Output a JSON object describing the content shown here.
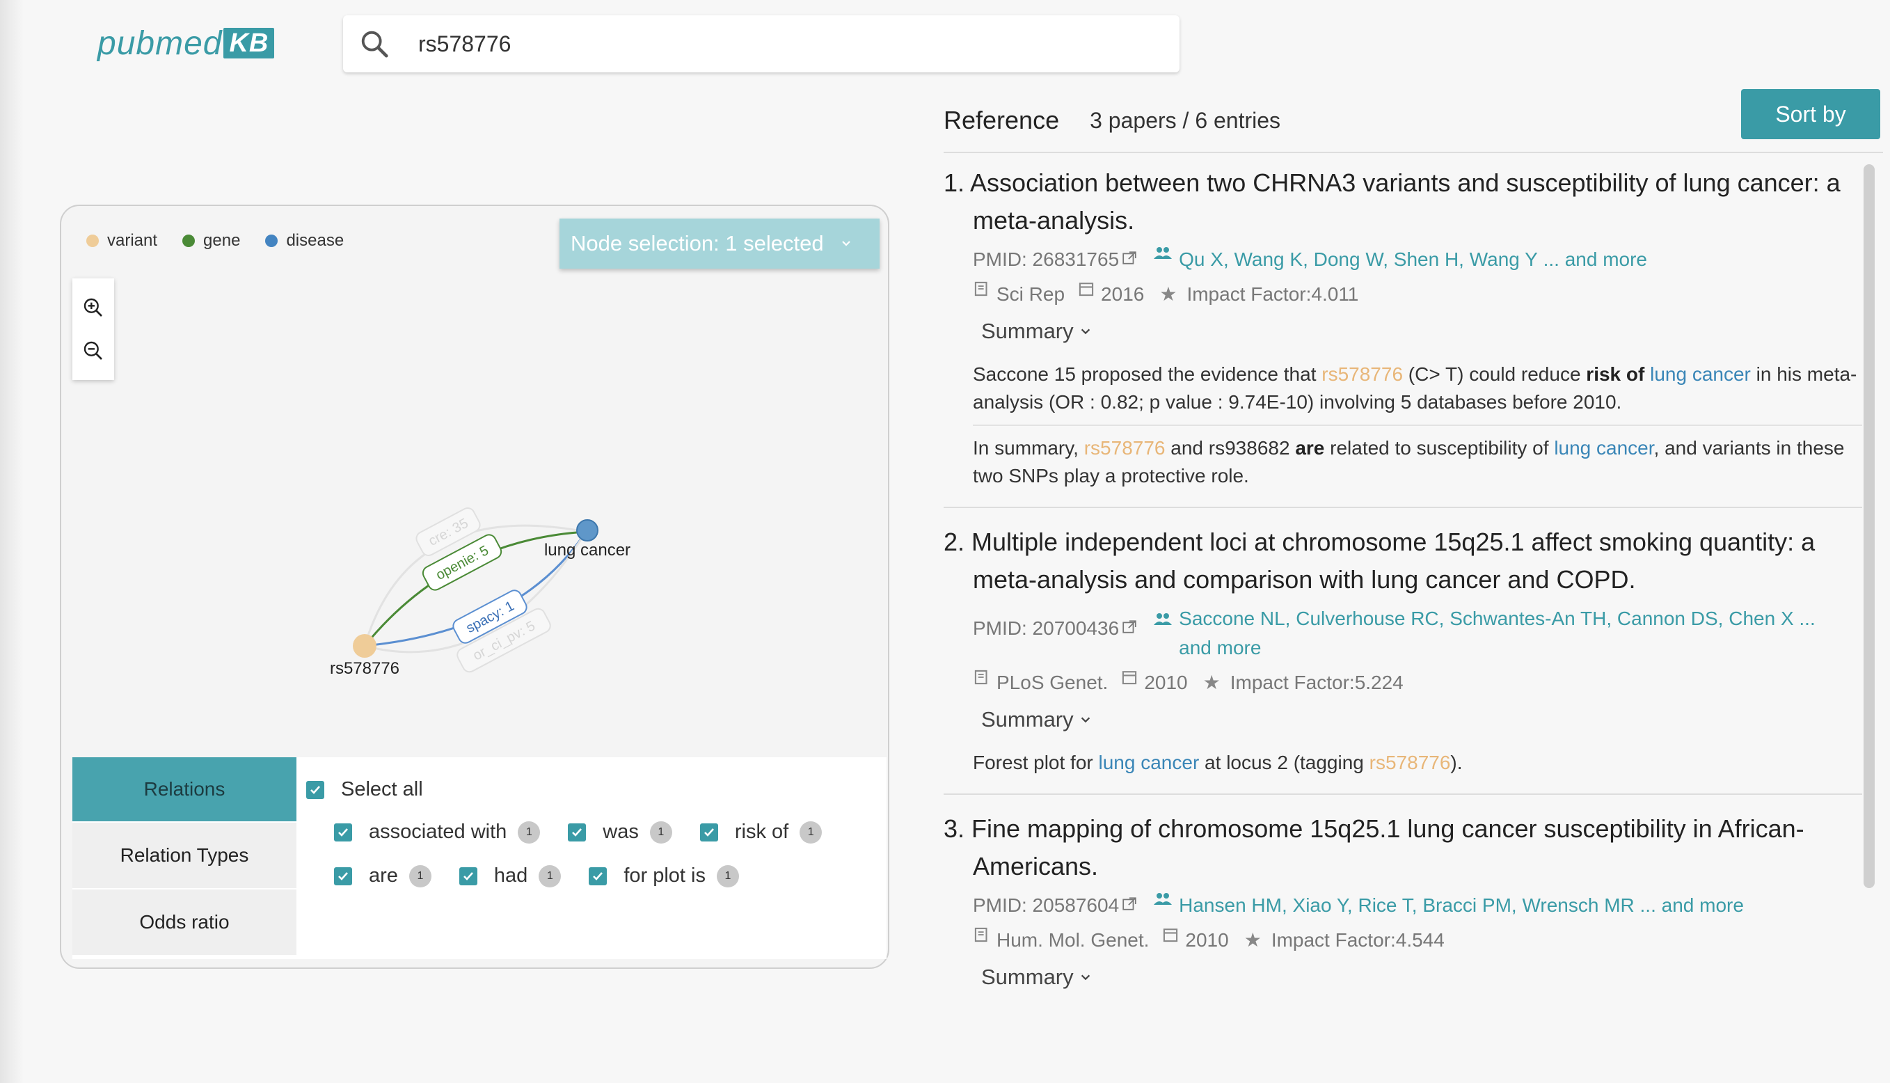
{
  "app": {
    "logo_text": "pubmed",
    "logo_badge": "KB"
  },
  "search": {
    "value": "rs578776",
    "icon": "search-icon"
  },
  "graph": {
    "legend": [
      {
        "label": "variant",
        "color": "#efcc98"
      },
      {
        "label": "gene",
        "color": "#4a8a36"
      },
      {
        "label": "disease",
        "color": "#4384c1"
      }
    ],
    "node_selection_label": "Node selection: 1 selected",
    "nodes": {
      "variant": "rs578776",
      "disease": "lung cancer"
    },
    "edge_labels": {
      "cre": "cre: 35",
      "openie": "openie: 5",
      "spacy": "spacy: 1",
      "or_ci_pv": "or_ci_pv: 5"
    }
  },
  "filters": {
    "tabs": [
      "Relations",
      "Relation Types",
      "Odds ratio"
    ],
    "select_all_label": "Select all",
    "relations": [
      {
        "label": "associated with",
        "count": "1"
      },
      {
        "label": "was",
        "count": "1"
      },
      {
        "label": "risk of",
        "count": "1"
      },
      {
        "label": "are",
        "count": "1"
      },
      {
        "label": "had",
        "count": "1"
      },
      {
        "label": "for plot is",
        "count": "1"
      }
    ]
  },
  "reference": {
    "title": "Reference",
    "count_text": "3 papers / 6 entries",
    "sort_label": "Sort by",
    "papers": [
      {
        "title": "1. Association between two CHRNA3 variants and susceptibility of lung cancer: a meta-analysis.",
        "pmid": "PMID: 26831765",
        "authors": "Qu X, Wang K, Dong W, Shen H, Wang Y",
        "more": "... and more",
        "journal": "Sci Rep",
        "year": "2016",
        "impact": "Impact Factor:4.011",
        "summary_label": "Summary",
        "summaries": [
          {
            "p1": "Saccone 15 proposed the evidence that ",
            "variant": "rs578776",
            "p2": " (C> T) could reduce ",
            "b1": "risk of",
            "p3": " ",
            "disease": "lung cancer",
            "p4": " in his meta-analysis (OR : 0.82; p value : 9.74E-10) involving 5 databases before 2010."
          },
          {
            "p1": "In summary, ",
            "variant": "rs578776",
            "p2": " and rs938682 ",
            "b1": "are",
            "p3": " related to susceptibility of ",
            "disease": "lung cancer",
            "p4": ", and variants in these two SNPs play a protective role."
          }
        ]
      },
      {
        "title": "2. Multiple independent loci at chromosome 15q25.1 affect smoking quantity: a meta-analysis and comparison with lung cancer and COPD.",
        "pmid": "PMID: 20700436",
        "authors": "Saccone NL, Culverhouse RC, Schwantes-An TH, Cannon DS, Chen X",
        "more": "... and more",
        "journal": "PLoS Genet.",
        "year": "2010",
        "impact": "Impact Factor:5.224",
        "summary_label": "Summary",
        "summary": {
          "p1": "Forest plot for ",
          "disease": "lung cancer",
          "p2": " at locus 2 (tagging ",
          "variant": "rs578776",
          "p3": ")."
        }
      },
      {
        "title": "3. Fine mapping of chromosome 15q25.1 lung cancer susceptibility in African-Americans.",
        "pmid": "PMID: 20587604",
        "authors": "Hansen HM, Xiao Y, Rice T, Bracci PM, Wrensch MR",
        "more": "... and more",
        "journal": "Hum. Mol. Genet.",
        "year": "2010",
        "impact": "Impact Factor:4.544",
        "summary_label": "Summary"
      }
    ]
  }
}
